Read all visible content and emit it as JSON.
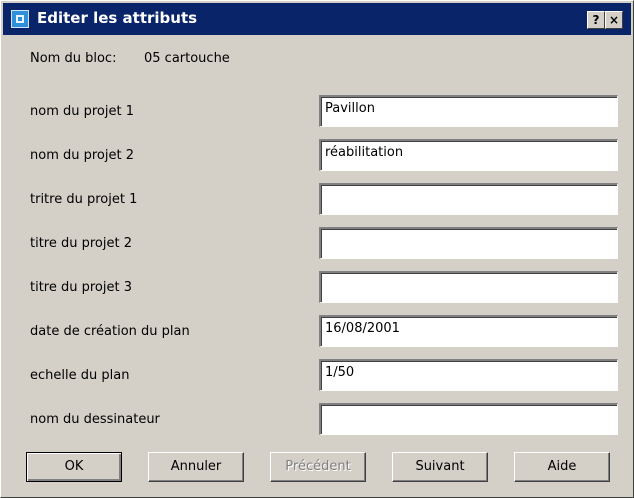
{
  "window": {
    "title": "Editer les attributs",
    "help_button": "?",
    "close_button": "×"
  },
  "block": {
    "label": "Nom du bloc:",
    "value": "05 cartouche"
  },
  "fields": [
    {
      "label": "nom du projet 1",
      "value": "Pavillon"
    },
    {
      "label": "nom du projet 2",
      "value": "réabilitation"
    },
    {
      "label": "tritre du projet 1",
      "value": ""
    },
    {
      "label": "titre du projet 2",
      "value": ""
    },
    {
      "label": "titre du projet 3",
      "value": ""
    },
    {
      "label": "date de création du plan",
      "value": "16/08/2001"
    },
    {
      "label": "echelle du plan",
      "value": "1/50"
    },
    {
      "label": "nom du dessinateur",
      "value": ""
    }
  ],
  "buttons": {
    "ok": "OK",
    "cancel": "Annuler",
    "previous": "Précédent",
    "next": "Suivant",
    "help": "Aide"
  },
  "colors": {
    "titlebar": "#0a246a",
    "dialog_background": "#d4d0c8",
    "disabled_text": "#808080"
  }
}
